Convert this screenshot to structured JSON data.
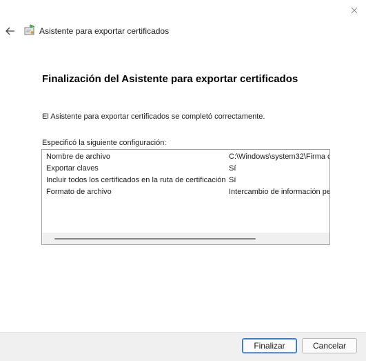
{
  "window": {
    "title": "Asistente para exportar certificados",
    "icons": {
      "close": "close-icon",
      "back": "back-arrow-icon",
      "app": "certificate-wizard-icon"
    }
  },
  "page": {
    "heading": "Finalización del Asistente para exportar certificados",
    "message": "El Asistente para exportar certificados se completó correctamente.",
    "settings_label": "Especificó la siguiente configuración:"
  },
  "settings": [
    {
      "name": "Nombre de archivo",
      "value": "C:\\Windows\\system32\\Firma c"
    },
    {
      "name": "Exportar claves",
      "value": "Sí"
    },
    {
      "name": "Incluir todos los certificados en la ruta de certificación",
      "value": "Sí"
    },
    {
      "name": "Formato de archivo",
      "value": "Intercambio de información pe"
    }
  ],
  "buttons": {
    "finish": "Finalizar",
    "cancel": "Cancelar"
  }
}
